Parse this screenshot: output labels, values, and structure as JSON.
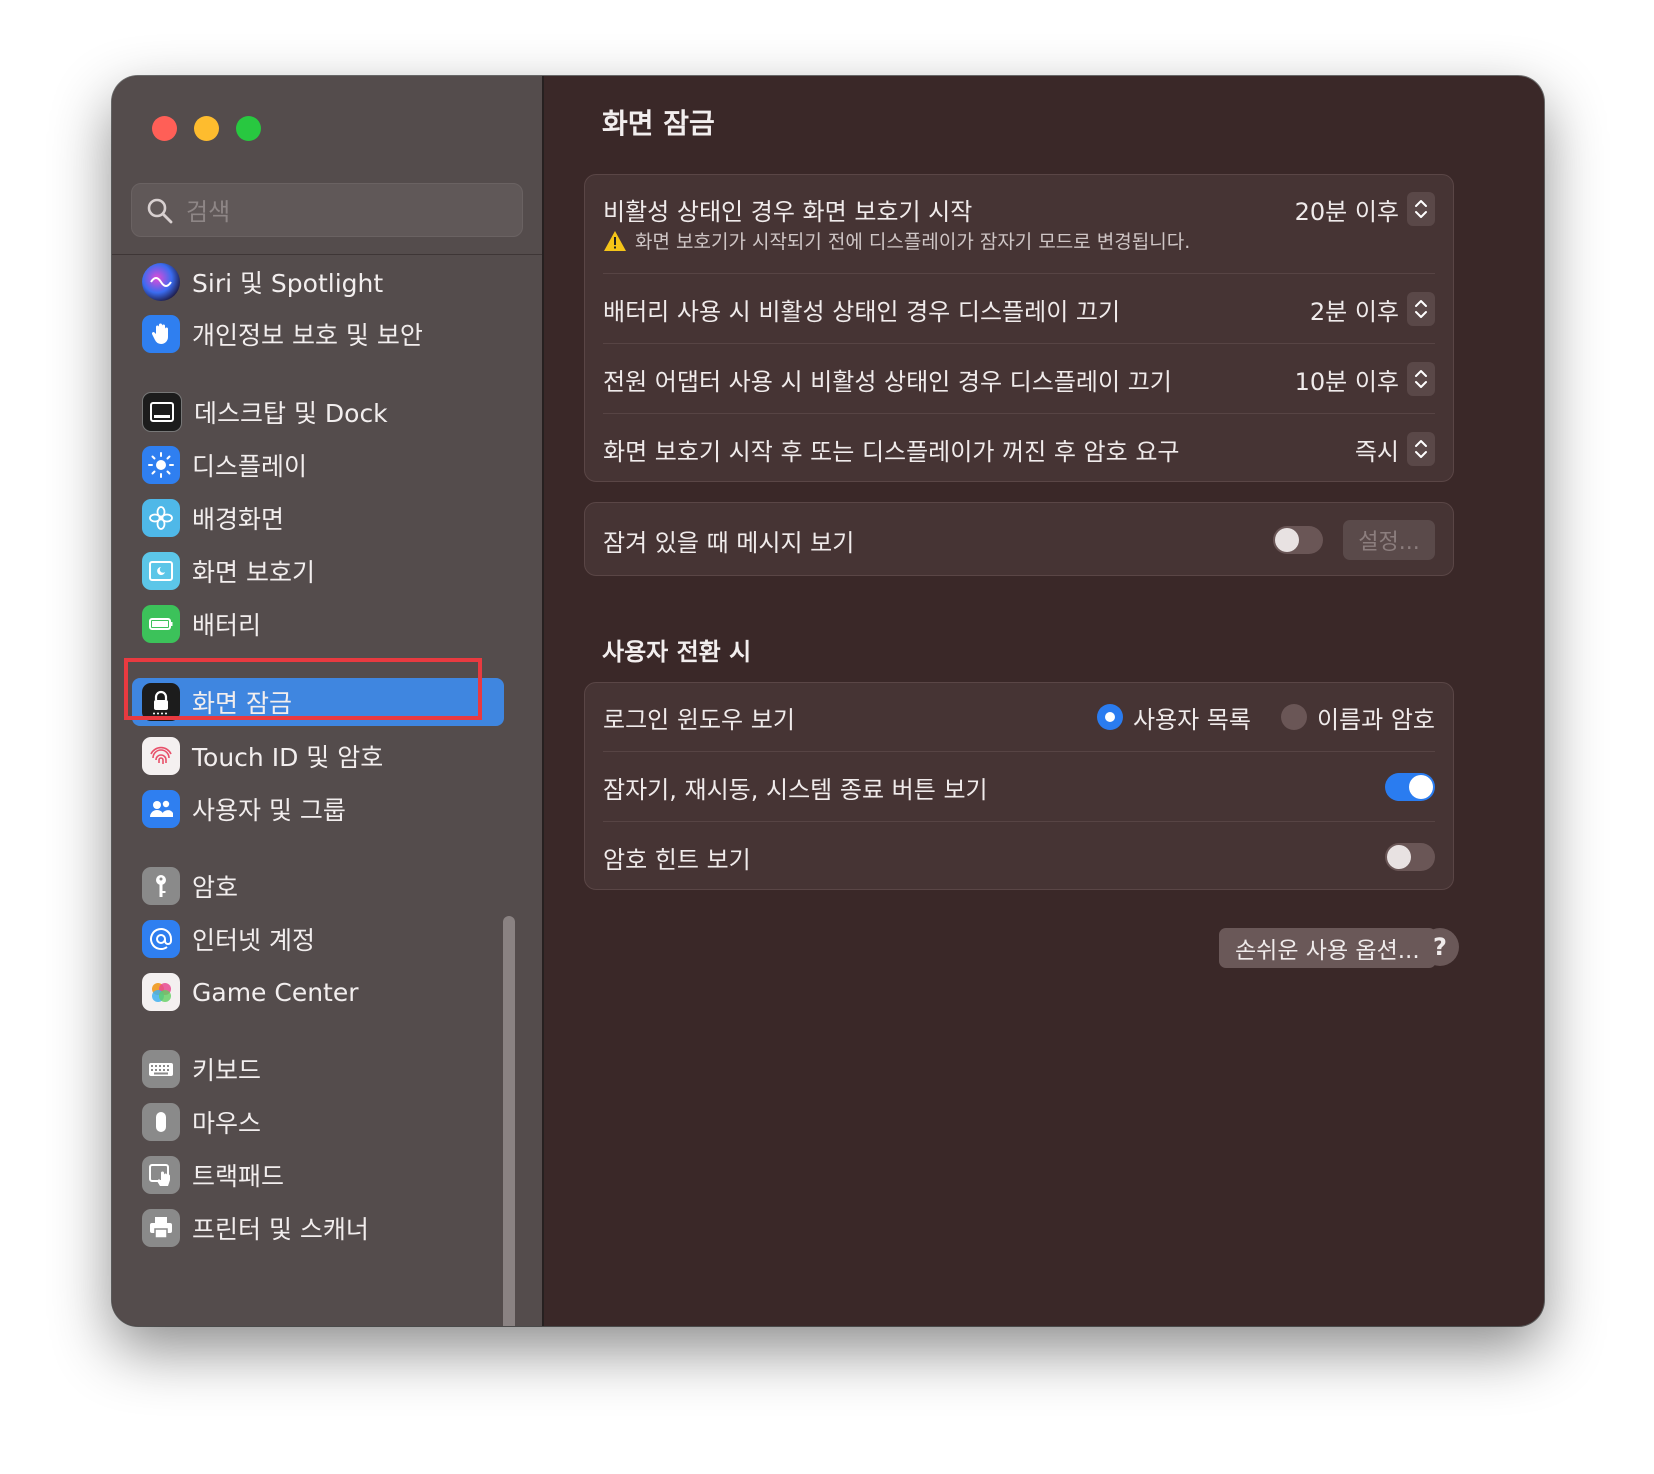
{
  "window": {
    "traffic_lights": [
      "close",
      "minimize",
      "zoom"
    ]
  },
  "sidebar": {
    "search_placeholder": "검색",
    "items": [
      {
        "label": "Siri 및 Spotlight",
        "icon": "siri-icon",
        "color": "#2a1a4a"
      },
      {
        "label": "개인정보 보호 및 보안",
        "icon": "hand-icon",
        "color": "#2f7ff0"
      },
      {
        "label": "데스크탑 및 Dock",
        "icon": "dock-icon",
        "color": "#1c1c1c"
      },
      {
        "label": "디스플레이",
        "icon": "sun-icon",
        "color": "#2f7ff0"
      },
      {
        "label": "배경화면",
        "icon": "flower-icon",
        "color": "#4fb8e8"
      },
      {
        "label": "화면 보호기",
        "icon": "screensaver-icon",
        "color": "#5cc6e8"
      },
      {
        "label": "배터리",
        "icon": "battery-icon",
        "color": "#3cc25a"
      },
      {
        "label": "화면 잠금",
        "icon": "lock-icon",
        "color": "#1c1c1c",
        "active": true
      },
      {
        "label": "Touch ID 및 암호",
        "icon": "fingerprint-icon",
        "color": "#f4f0f0"
      },
      {
        "label": "사용자 및 그룹",
        "icon": "users-icon",
        "color": "#2f7ff0"
      },
      {
        "label": "암호",
        "icon": "key-icon",
        "color": "#8a8a8a"
      },
      {
        "label": "인터넷 계정",
        "icon": "at-icon",
        "color": "#2f7ff0"
      },
      {
        "label": "Game Center",
        "icon": "game-center-icon",
        "color": "#f4f0f0"
      },
      {
        "label": "키보드",
        "icon": "keyboard-icon",
        "color": "#8a8a8a"
      },
      {
        "label": "마우스",
        "icon": "mouse-icon",
        "color": "#8a8a8a"
      },
      {
        "label": "트랙패드",
        "icon": "trackpad-icon",
        "color": "#8a8a8a"
      },
      {
        "label": "프린터 및 스캐너",
        "icon": "printer-icon",
        "color": "#8a8a8a"
      }
    ]
  },
  "main": {
    "title": "화면 잠금",
    "timing_card": {
      "rows": [
        {
          "label": "비활성 상태인 경우 화면 보호기 시작",
          "value": "20분 이후"
        },
        {
          "label": "배터리 사용 시 비활성 상태인 경우 디스플레이 끄기",
          "value": "2분 이후"
        },
        {
          "label": "전원 어댑터 사용 시 비활성 상태인 경우 디스플레이 끄기",
          "value": "10분 이후"
        },
        {
          "label": "화면 보호기 시작 후 또는 디스플레이가 꺼진 후 암호 요구",
          "value": "즉시"
        }
      ],
      "warning": "화면 보호기가 시작되기 전에 디스플레이가 잠자기 모드로 변경됩니다."
    },
    "message_card": {
      "label": "잠겨 있을 때 메시지 보기",
      "toggle_on": false,
      "settings_button": "설정..."
    },
    "user_switch": {
      "section_title": "사용자 전환 시",
      "login_window_label": "로그인 윈도우 보기",
      "radio_options": [
        "사용자 목록",
        "이름과 암호"
      ],
      "selected_option": "사용자 목록",
      "sleep_restart_label": "잠자기, 재시동, 시스템 종료 버튼 보기",
      "sleep_restart_on": true,
      "hint_label": "암호 힌트 보기",
      "hint_on": false
    },
    "accessibility_button": "손쉬운 사용 옵션...",
    "help_button": "?"
  },
  "colors": {
    "accent": "#2a7cf0",
    "sidebar_bg": "#544c4c",
    "main_bg": "#3a2828",
    "highlight_border": "#e83a40"
  }
}
